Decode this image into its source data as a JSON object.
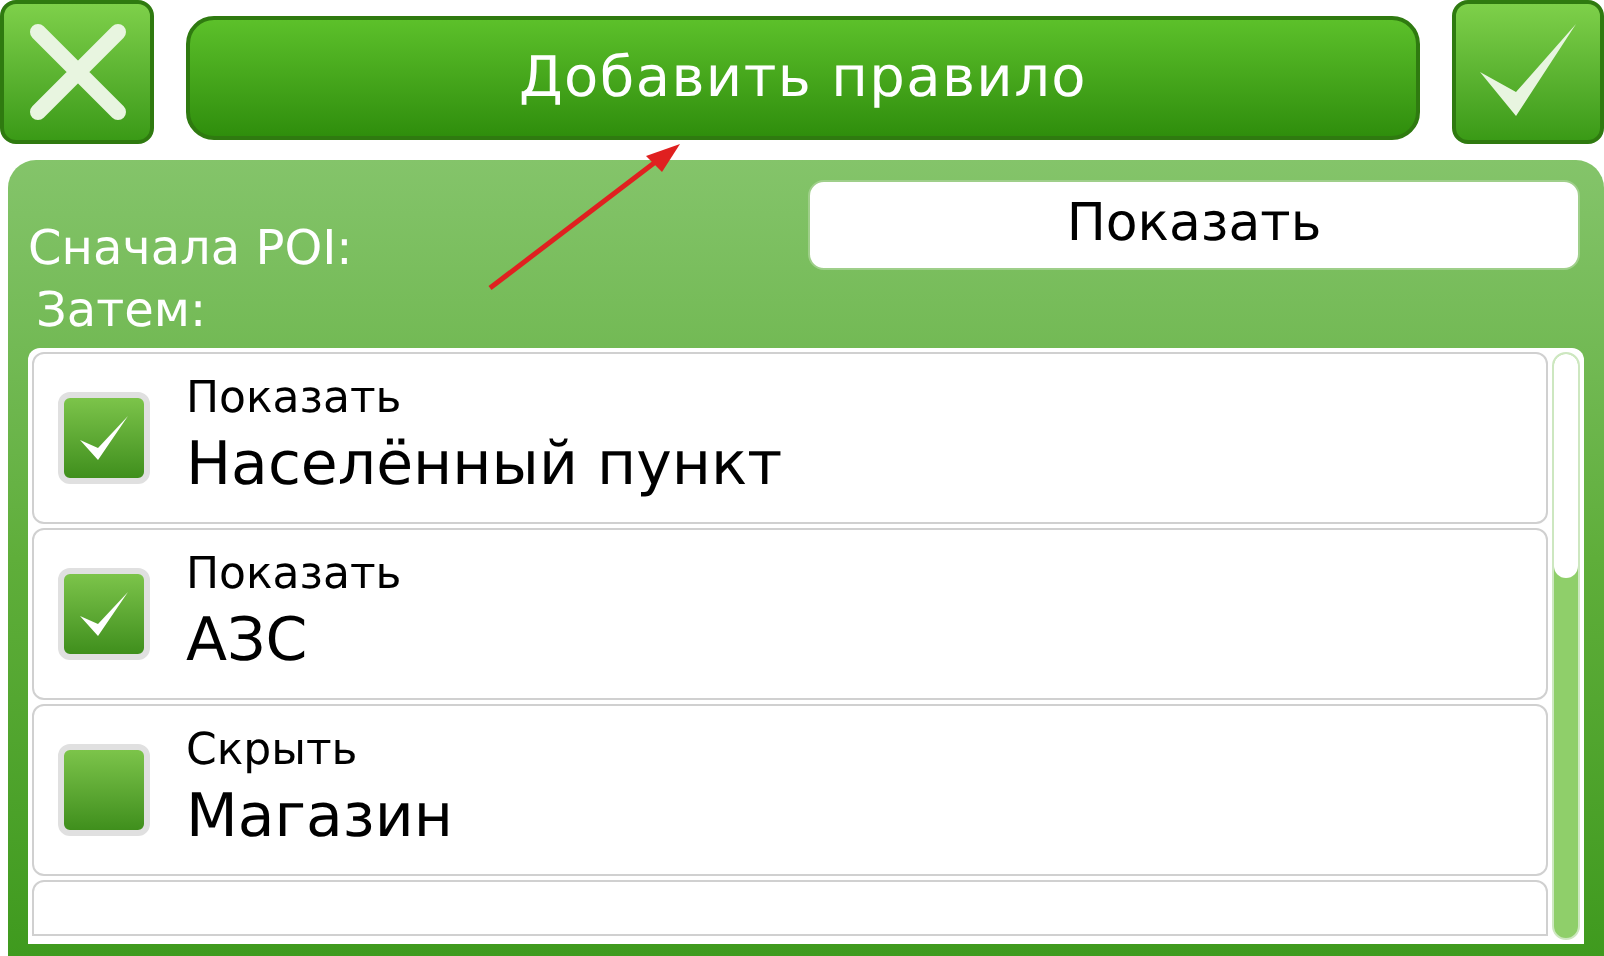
{
  "header": {
    "title": "Добавить правило"
  },
  "first": {
    "label": "Сначала POI:",
    "value": "Показать"
  },
  "then": {
    "label": "Затем:"
  },
  "rules": [
    {
      "action": "Показать",
      "category": "Населённый пункт",
      "checked": true
    },
    {
      "action": "Показать",
      "category": "АЗС",
      "checked": true
    },
    {
      "action": "Скрыть",
      "category": "Магазин",
      "checked": false
    }
  ]
}
